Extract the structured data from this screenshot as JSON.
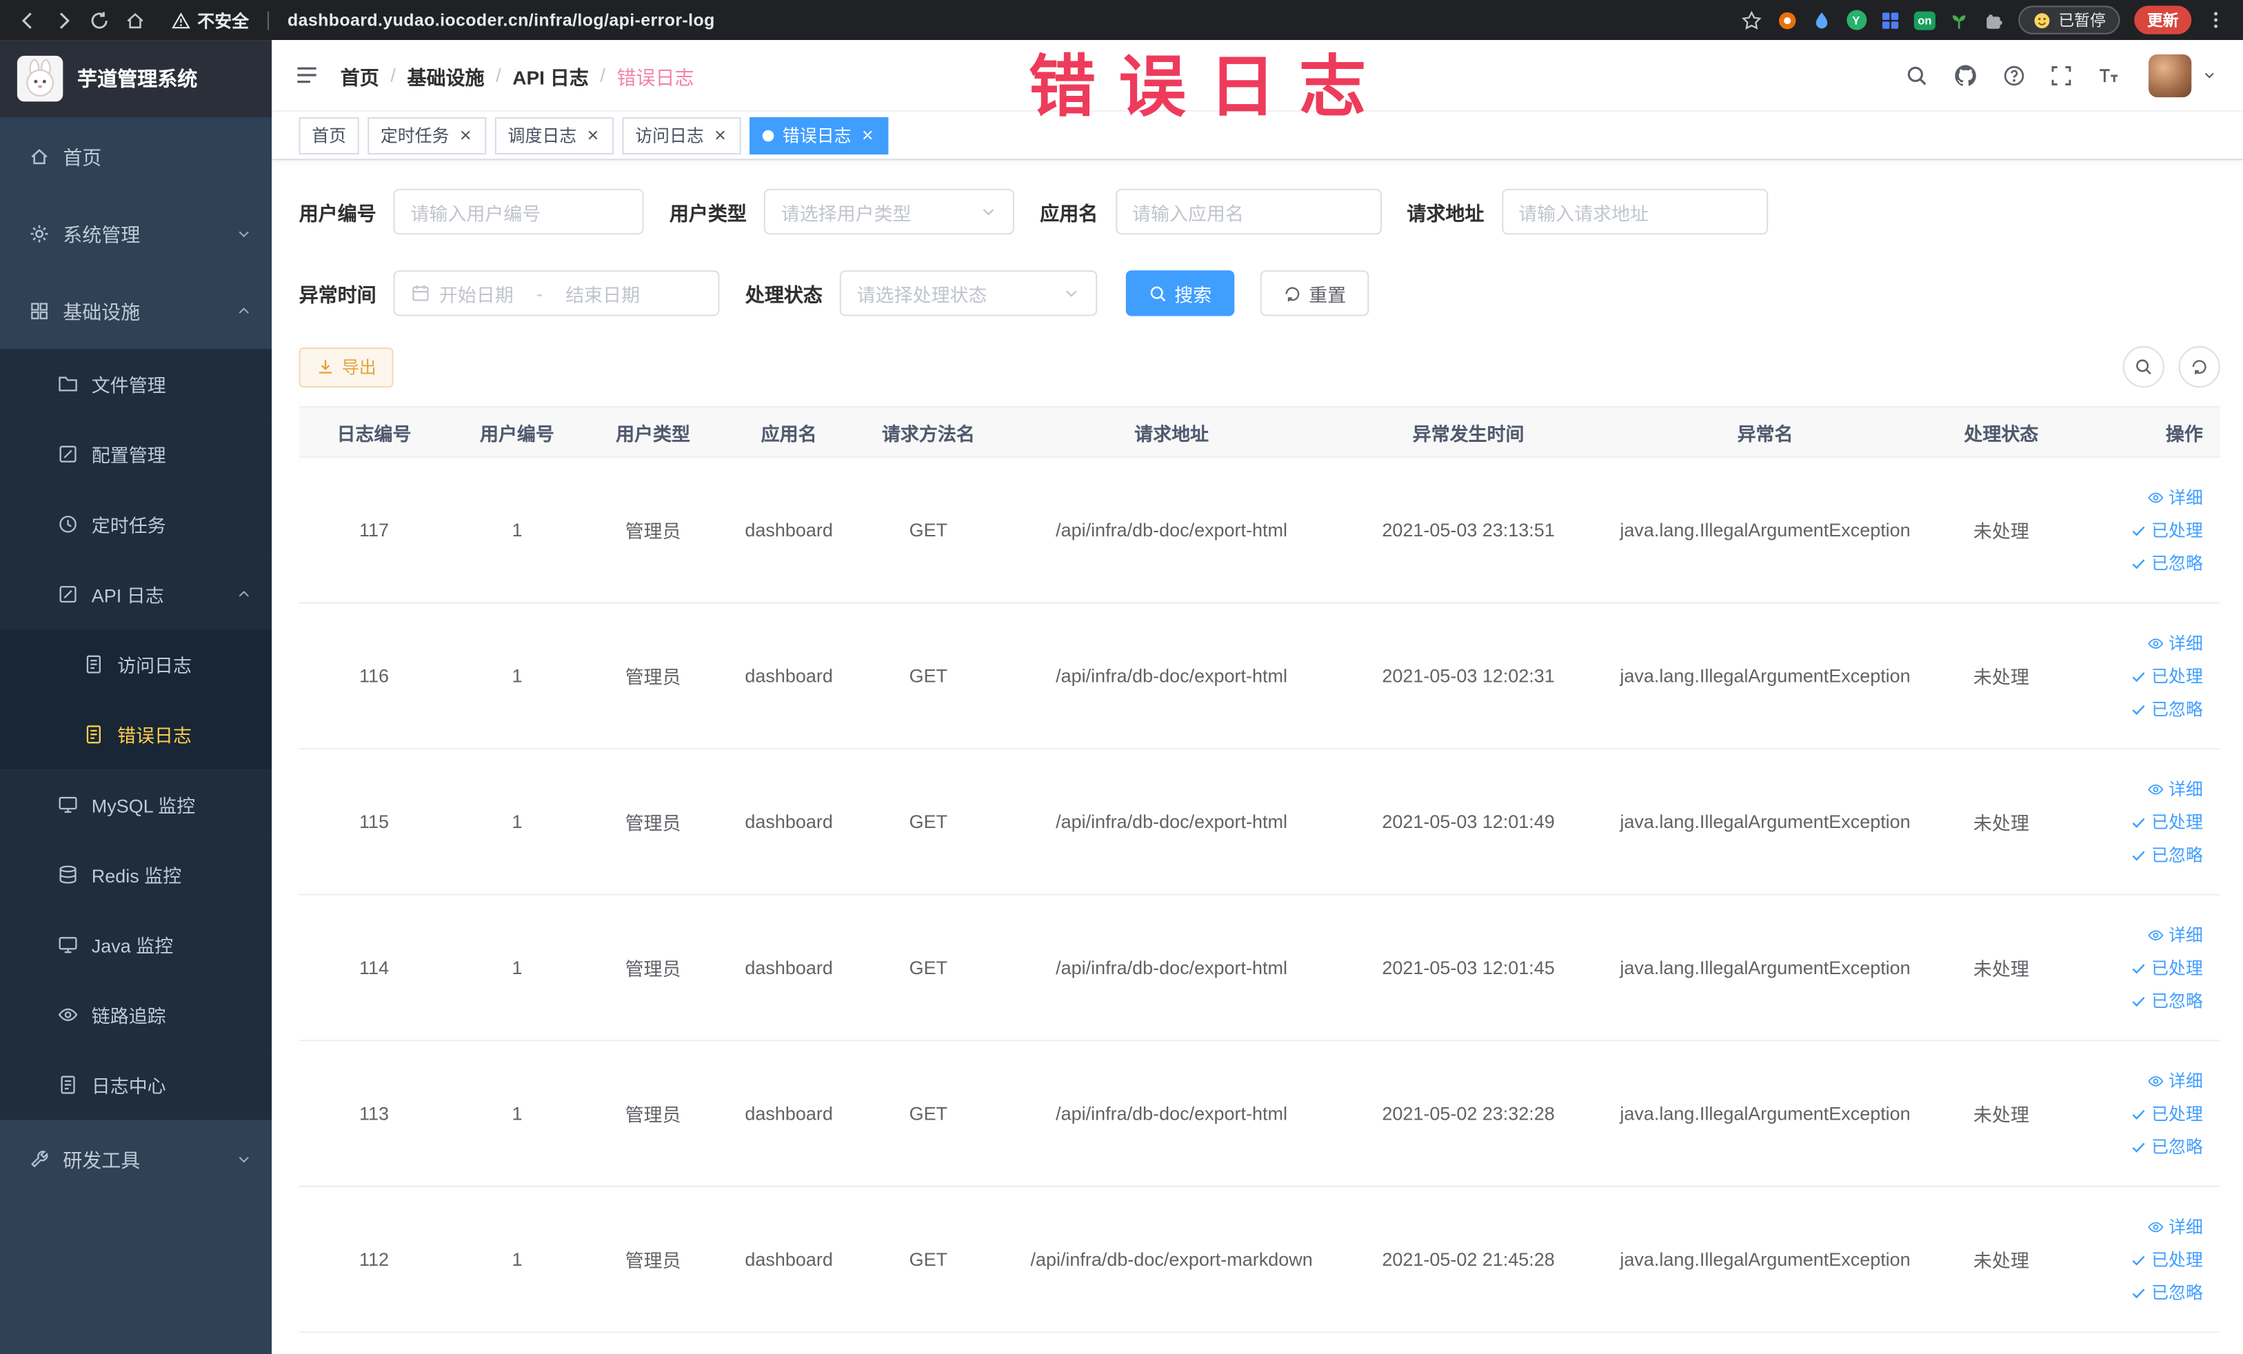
{
  "browser": {
    "security_label": "不安全",
    "url": "dashboard.yudao.iocoder.cn/infra/log/api-error-log",
    "paused_label": "已暂停",
    "update_label": "更新",
    "extensions": [
      {
        "key": "record-extension",
        "icon": "record",
        "color": "#e8710a"
      },
      {
        "key": "drop-extension",
        "icon": "drop",
        "color": "#5aa7ff"
      },
      {
        "key": "green-dot-extension",
        "icon": "circle",
        "color": "#27b36b",
        "text": "Y"
      },
      {
        "key": "grid-extension",
        "icon": "grid-badge",
        "color": "#4f7df9"
      },
      {
        "key": "on-switch-extension",
        "icon": "badge",
        "color": "#17a05e",
        "text": "on"
      },
      {
        "key": "sprout-extension",
        "icon": "sprout",
        "color": "#3fae4e"
      },
      {
        "key": "puzzle-extension",
        "icon": "puzzle",
        "color": "#a6abb3"
      }
    ]
  },
  "watermark": "错误日志",
  "sidebar": {
    "logo_title": "芋道管理系统",
    "items": [
      {
        "key": "home",
        "label": "首页",
        "icon": "home",
        "level": 0
      },
      {
        "key": "system",
        "label": "系统管理",
        "icon": "gear",
        "level": 0,
        "chevron": "down"
      },
      {
        "key": "infra",
        "label": "基础设施",
        "icon": "grid",
        "level": 0,
        "chevron": "up"
      },
      {
        "key": "file",
        "label": "文件管理",
        "icon": "folder",
        "level": 1
      },
      {
        "key": "config",
        "label": "配置管理",
        "icon": "edit",
        "level": 1
      },
      {
        "key": "job",
        "label": "定时任务",
        "icon": "clock",
        "level": 1
      },
      {
        "key": "api-log",
        "label": "API 日志",
        "icon": "edit",
        "level": 1,
        "chevron": "up"
      },
      {
        "key": "access-log",
        "label": "访问日志",
        "icon": "doc",
        "level": 2
      },
      {
        "key": "error-log",
        "label": "错误日志",
        "icon": "doc",
        "level": 2,
        "active": true
      },
      {
        "key": "mysql",
        "label": "MySQL 监控",
        "icon": "monitor",
        "level": 1
      },
      {
        "key": "redis",
        "label": "Redis 监控",
        "icon": "disks",
        "level": 1
      },
      {
        "key": "java",
        "label": "Java 监控",
        "icon": "monitor",
        "level": 1
      },
      {
        "key": "trace",
        "label": "链路追踪",
        "icon": "eye",
        "level": 1
      },
      {
        "key": "log-center",
        "label": "日志中心",
        "icon": "doc",
        "level": 1
      },
      {
        "key": "dev-tools",
        "label": "研发工具",
        "icon": "wrench",
        "level": 0,
        "chevron": "down"
      }
    ]
  },
  "navbar": {
    "breadcrumb": [
      "首页",
      "基础设施",
      "API 日志",
      "错误日志"
    ]
  },
  "tags": [
    {
      "key": "home",
      "label": "首页",
      "closable": false,
      "active": false
    },
    {
      "key": "job",
      "label": "定时任务",
      "closable": true,
      "active": false
    },
    {
      "key": "job-log",
      "label": "调度日志",
      "closable": true,
      "active": false
    },
    {
      "key": "access-log",
      "label": "访问日志",
      "closable": true,
      "active": false
    },
    {
      "key": "error-log",
      "label": "错误日志",
      "closable": true,
      "active": true
    }
  ],
  "filters": {
    "user_id": {
      "label": "用户编号",
      "placeholder": "请输入用户编号"
    },
    "user_type": {
      "label": "用户类型",
      "placeholder": "请选择用户类型"
    },
    "app_name": {
      "label": "应用名",
      "placeholder": "请输入应用名"
    },
    "request_url": {
      "label": "请求地址",
      "placeholder": "请输入请求地址"
    },
    "exception_time": {
      "label": "异常时间",
      "start_placeholder": "开始日期",
      "separator": "-",
      "end_placeholder": "结束日期"
    },
    "process_status": {
      "label": "处理状态",
      "placeholder": "请选择处理状态"
    },
    "search_label": "搜索",
    "reset_label": "重置"
  },
  "toolbar": {
    "export_label": "导出"
  },
  "table": {
    "columns": [
      {
        "key": "id",
        "label": "日志编号"
      },
      {
        "key": "user_id",
        "label": "用户编号"
      },
      {
        "key": "user_type",
        "label": "用户类型"
      },
      {
        "key": "app_name",
        "label": "应用名"
      },
      {
        "key": "method",
        "label": "请求方法名"
      },
      {
        "key": "url",
        "label": "请求地址"
      },
      {
        "key": "time",
        "label": "异常发生时间"
      },
      {
        "key": "exception",
        "label": "异常名"
      },
      {
        "key": "status",
        "label": "处理状态"
      },
      {
        "key": "actions",
        "label": "操作"
      }
    ],
    "actions": [
      {
        "key": "detail",
        "label": "详细",
        "icon": "eye"
      },
      {
        "key": "processed",
        "label": "已处理",
        "icon": "check"
      },
      {
        "key": "ignored",
        "label": "已忽略",
        "icon": "check"
      }
    ],
    "rows": [
      {
        "id": "117",
        "user_id": "1",
        "user_type": "管理员",
        "app_name": "dashboard",
        "method": "GET",
        "url": "/api/infra/db-doc/export-html",
        "time": "2021-05-03 23:13:51",
        "exception": "java.lang.IllegalArgumentException",
        "status": "未处理"
      },
      {
        "id": "116",
        "user_id": "1",
        "user_type": "管理员",
        "app_name": "dashboard",
        "method": "GET",
        "url": "/api/infra/db-doc/export-html",
        "time": "2021-05-03 12:02:31",
        "exception": "java.lang.IllegalArgumentException",
        "status": "未处理"
      },
      {
        "id": "115",
        "user_id": "1",
        "user_type": "管理员",
        "app_name": "dashboard",
        "method": "GET",
        "url": "/api/infra/db-doc/export-html",
        "time": "2021-05-03 12:01:49",
        "exception": "java.lang.IllegalArgumentException",
        "status": "未处理"
      },
      {
        "id": "114",
        "user_id": "1",
        "user_type": "管理员",
        "app_name": "dashboard",
        "method": "GET",
        "url": "/api/infra/db-doc/export-html",
        "time": "2021-05-03 12:01:45",
        "exception": "java.lang.IllegalArgumentException",
        "status": "未处理"
      },
      {
        "id": "113",
        "user_id": "1",
        "user_type": "管理员",
        "app_name": "dashboard",
        "method": "GET",
        "url": "/api/infra/db-doc/export-html",
        "time": "2021-05-02 23:32:28",
        "exception": "java.lang.IllegalArgumentException",
        "status": "未处理"
      },
      {
        "id": "112",
        "user_id": "1",
        "user_type": "管理员",
        "app_name": "dashboard",
        "method": "GET",
        "url": "/api/infra/db-doc/export-markdown",
        "time": "2021-05-02 21:45:28",
        "exception": "java.lang.IllegalArgumentException",
        "status": "未处理"
      }
    ]
  },
  "colors": {
    "primary": "#409eff",
    "sidebar_bg": "#304156",
    "submenu_bg": "#1f2d3d",
    "active_menu_text": "#ffd04b",
    "watermark_red": "#ee3b5b",
    "warning_button_text": "#e6a23c"
  }
}
